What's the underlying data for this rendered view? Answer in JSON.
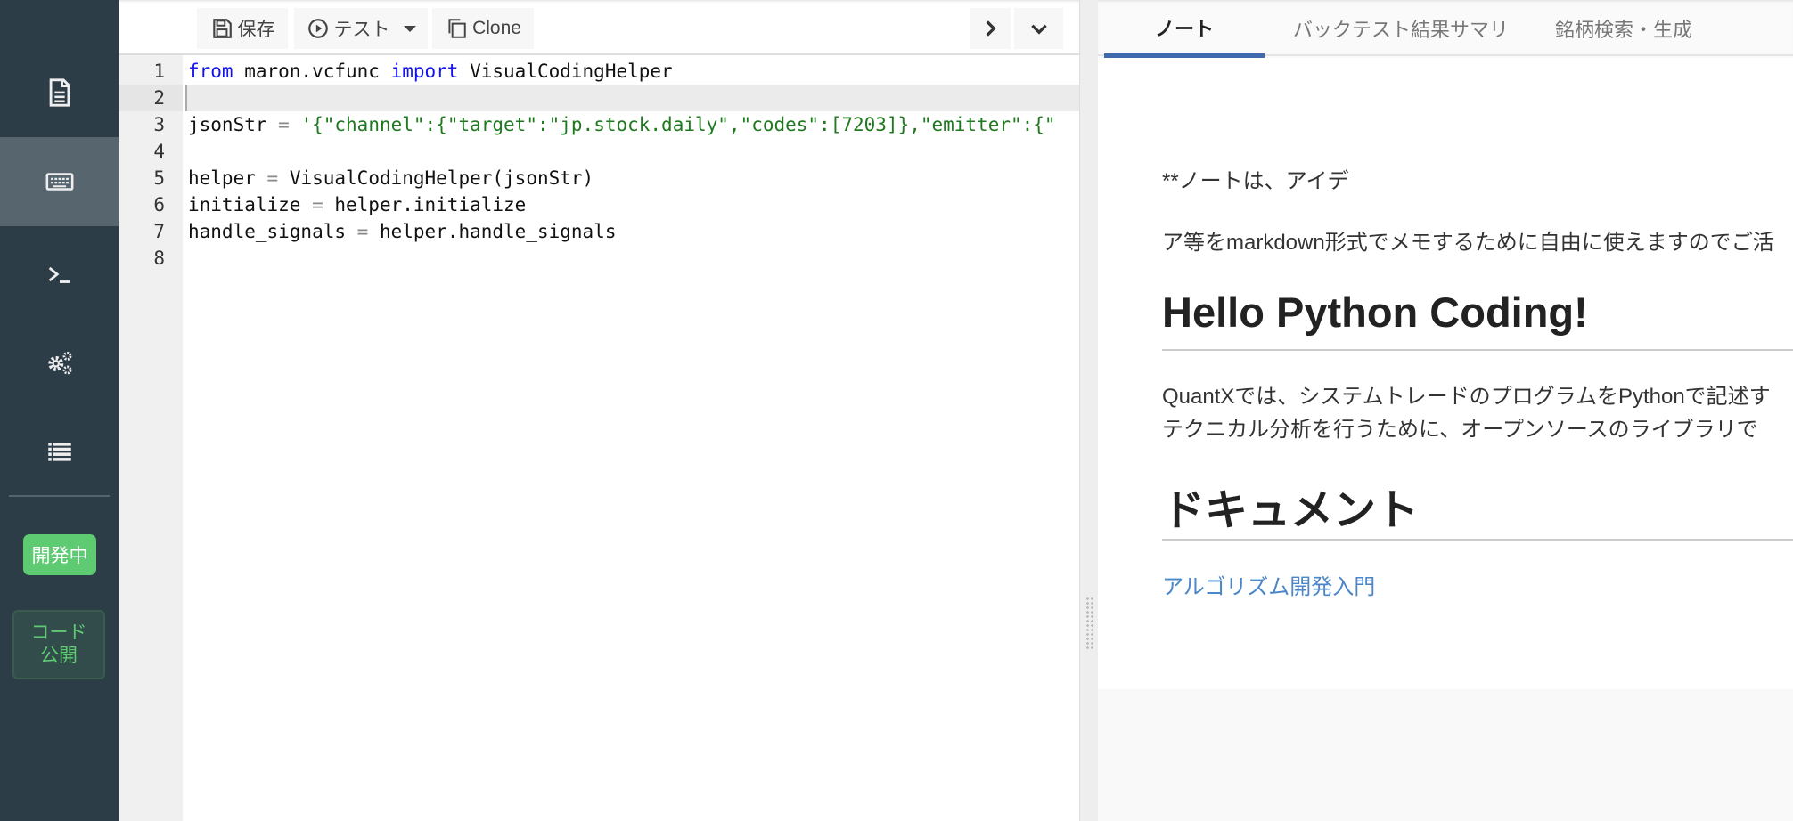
{
  "sidebar": {
    "items": [
      {
        "icon": "document-icon",
        "active": false
      },
      {
        "icon": "keyboard-icon",
        "active": true
      },
      {
        "icon": "terminal-icon",
        "active": false
      },
      {
        "icon": "gears-icon",
        "active": false
      },
      {
        "icon": "list-icon",
        "active": false
      }
    ],
    "status_badge": "開発中",
    "publish_button": "コード\n公開",
    "colors": {
      "bg": "#2d3d48",
      "active": "#56656e",
      "green": "#5ecb73"
    }
  },
  "toolbar": {
    "save_label": "保存",
    "test_label": "テスト",
    "clone_label": "Clone"
  },
  "editor": {
    "current_line": 2,
    "lines": [
      {
        "n": "1",
        "tokens": [
          {
            "t": "from",
            "c": "kw"
          },
          {
            "t": " maron.vcfunc ",
            "c": ""
          },
          {
            "t": "import",
            "c": "kw"
          },
          {
            "t": " VisualCodingHelper",
            "c": ""
          }
        ]
      },
      {
        "n": "2",
        "tokens": []
      },
      {
        "n": "3",
        "tokens": [
          {
            "t": "jsonStr ",
            "c": ""
          },
          {
            "t": "=",
            "c": "op"
          },
          {
            "t": " ",
            "c": ""
          },
          {
            "t": "'{\"channel\":{\"target\":\"jp.stock.daily\",\"codes\":[7203]},\"emitter\":{\"",
            "c": "str"
          }
        ]
      },
      {
        "n": "4",
        "tokens": []
      },
      {
        "n": "5",
        "tokens": [
          {
            "t": "helper ",
            "c": ""
          },
          {
            "t": "=",
            "c": "op"
          },
          {
            "t": " VisualCodingHelper(jsonStr)",
            "c": ""
          }
        ]
      },
      {
        "n": "6",
        "tokens": [
          {
            "t": "initialize ",
            "c": ""
          },
          {
            "t": "=",
            "c": "op"
          },
          {
            "t": " helper.initialize",
            "c": ""
          }
        ]
      },
      {
        "n": "7",
        "tokens": [
          {
            "t": "handle_signals ",
            "c": ""
          },
          {
            "t": "=",
            "c": "op"
          },
          {
            "t": " helper.handle_signals",
            "c": ""
          }
        ]
      },
      {
        "n": "8",
        "tokens": []
      }
    ]
  },
  "right_panel": {
    "tabs": [
      {
        "label": "ノート",
        "active": true
      },
      {
        "label": "バックテスト結果サマリ",
        "active": false
      },
      {
        "label": "銘柄検索・生成",
        "active": false
      }
    ],
    "note": {
      "para1": "**ノートは、アイデ",
      "para2": "ア等をmarkdown形式でメモするために自由に使えますのでご活",
      "heading1": "Hello Python Coding!",
      "para3_line1": "QuantXでは、システムトレードのプログラムをPythonで記述す",
      "para3_line2": "テクニカル分析を行うために、オープンソースのライブラリで",
      "heading2": "ドキュメント",
      "link": "アルゴリズム開発入門"
    },
    "accent": "#3f6aad",
    "link_color": "#4a86c8"
  }
}
